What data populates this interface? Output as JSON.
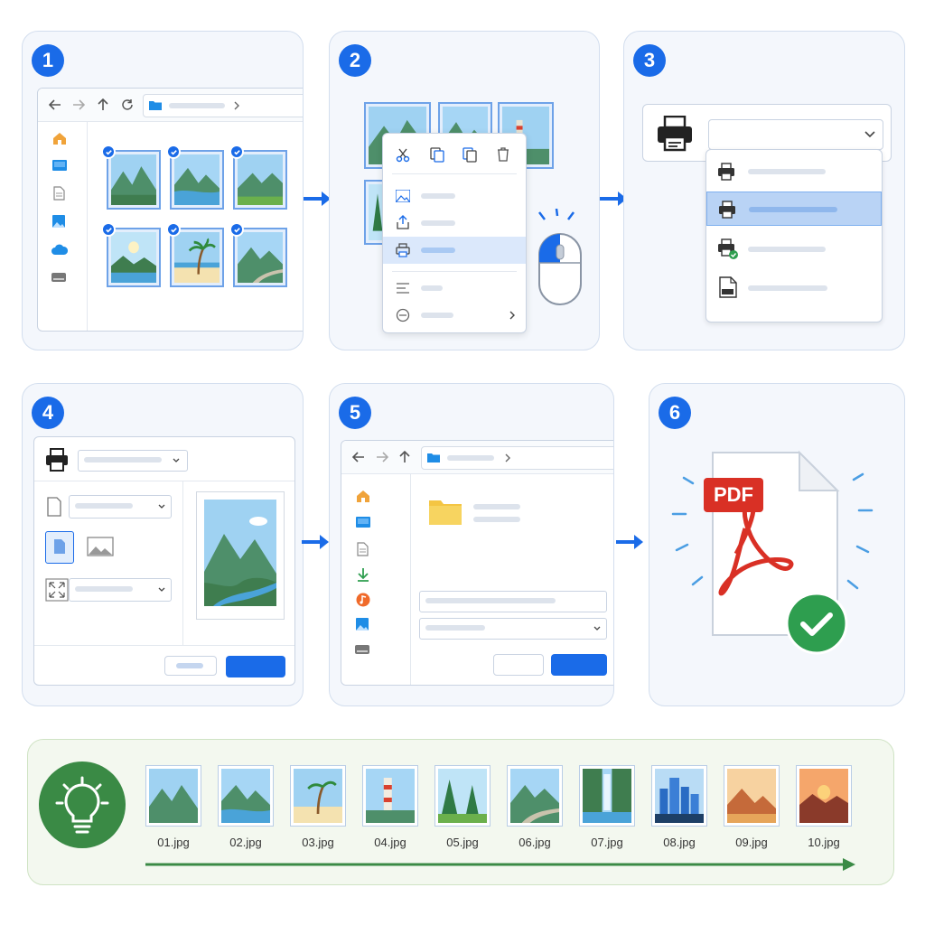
{
  "steps": [
    {
      "number": "1"
    },
    {
      "number": "2"
    },
    {
      "number": "3"
    },
    {
      "number": "4"
    },
    {
      "number": "5"
    },
    {
      "number": "6"
    }
  ],
  "pdf_label": "PDF",
  "file_names": [
    "01.jpg",
    "02.jpg",
    "03.jpg",
    "04.jpg",
    "05.jpg",
    "06.jpg",
    "07.jpg",
    "08.jpg",
    "09.jpg",
    "10.jpg"
  ],
  "icons": {
    "nav": [
      "back-icon",
      "forward-icon",
      "up-icon",
      "refresh-icon",
      "folder-icon",
      "chevron-right-icon"
    ],
    "sidebar": [
      "home-icon",
      "desktop-icon",
      "document-icon",
      "pictures-icon",
      "cloud-icon",
      "drive-icon"
    ],
    "context_menu_toolbar": [
      "cut-icon",
      "copy-icon",
      "paste-icon",
      "delete-icon"
    ],
    "context_menu": [
      "open-with-icon",
      "share-icon",
      "print-icon",
      "properties-icon",
      "more-options-icon"
    ],
    "printers": [
      "printer-icon",
      "printer-icon",
      "printer-default-icon",
      "pdf-printer-icon"
    ]
  },
  "colors": {
    "accent": "#1a6be8",
    "panel_bg": "#f4f7fc",
    "success": "#2e9e4f",
    "pdf_red": "#d93025",
    "tip_green": "#3a8a45",
    "tip_bg": "#f3f8ef"
  }
}
